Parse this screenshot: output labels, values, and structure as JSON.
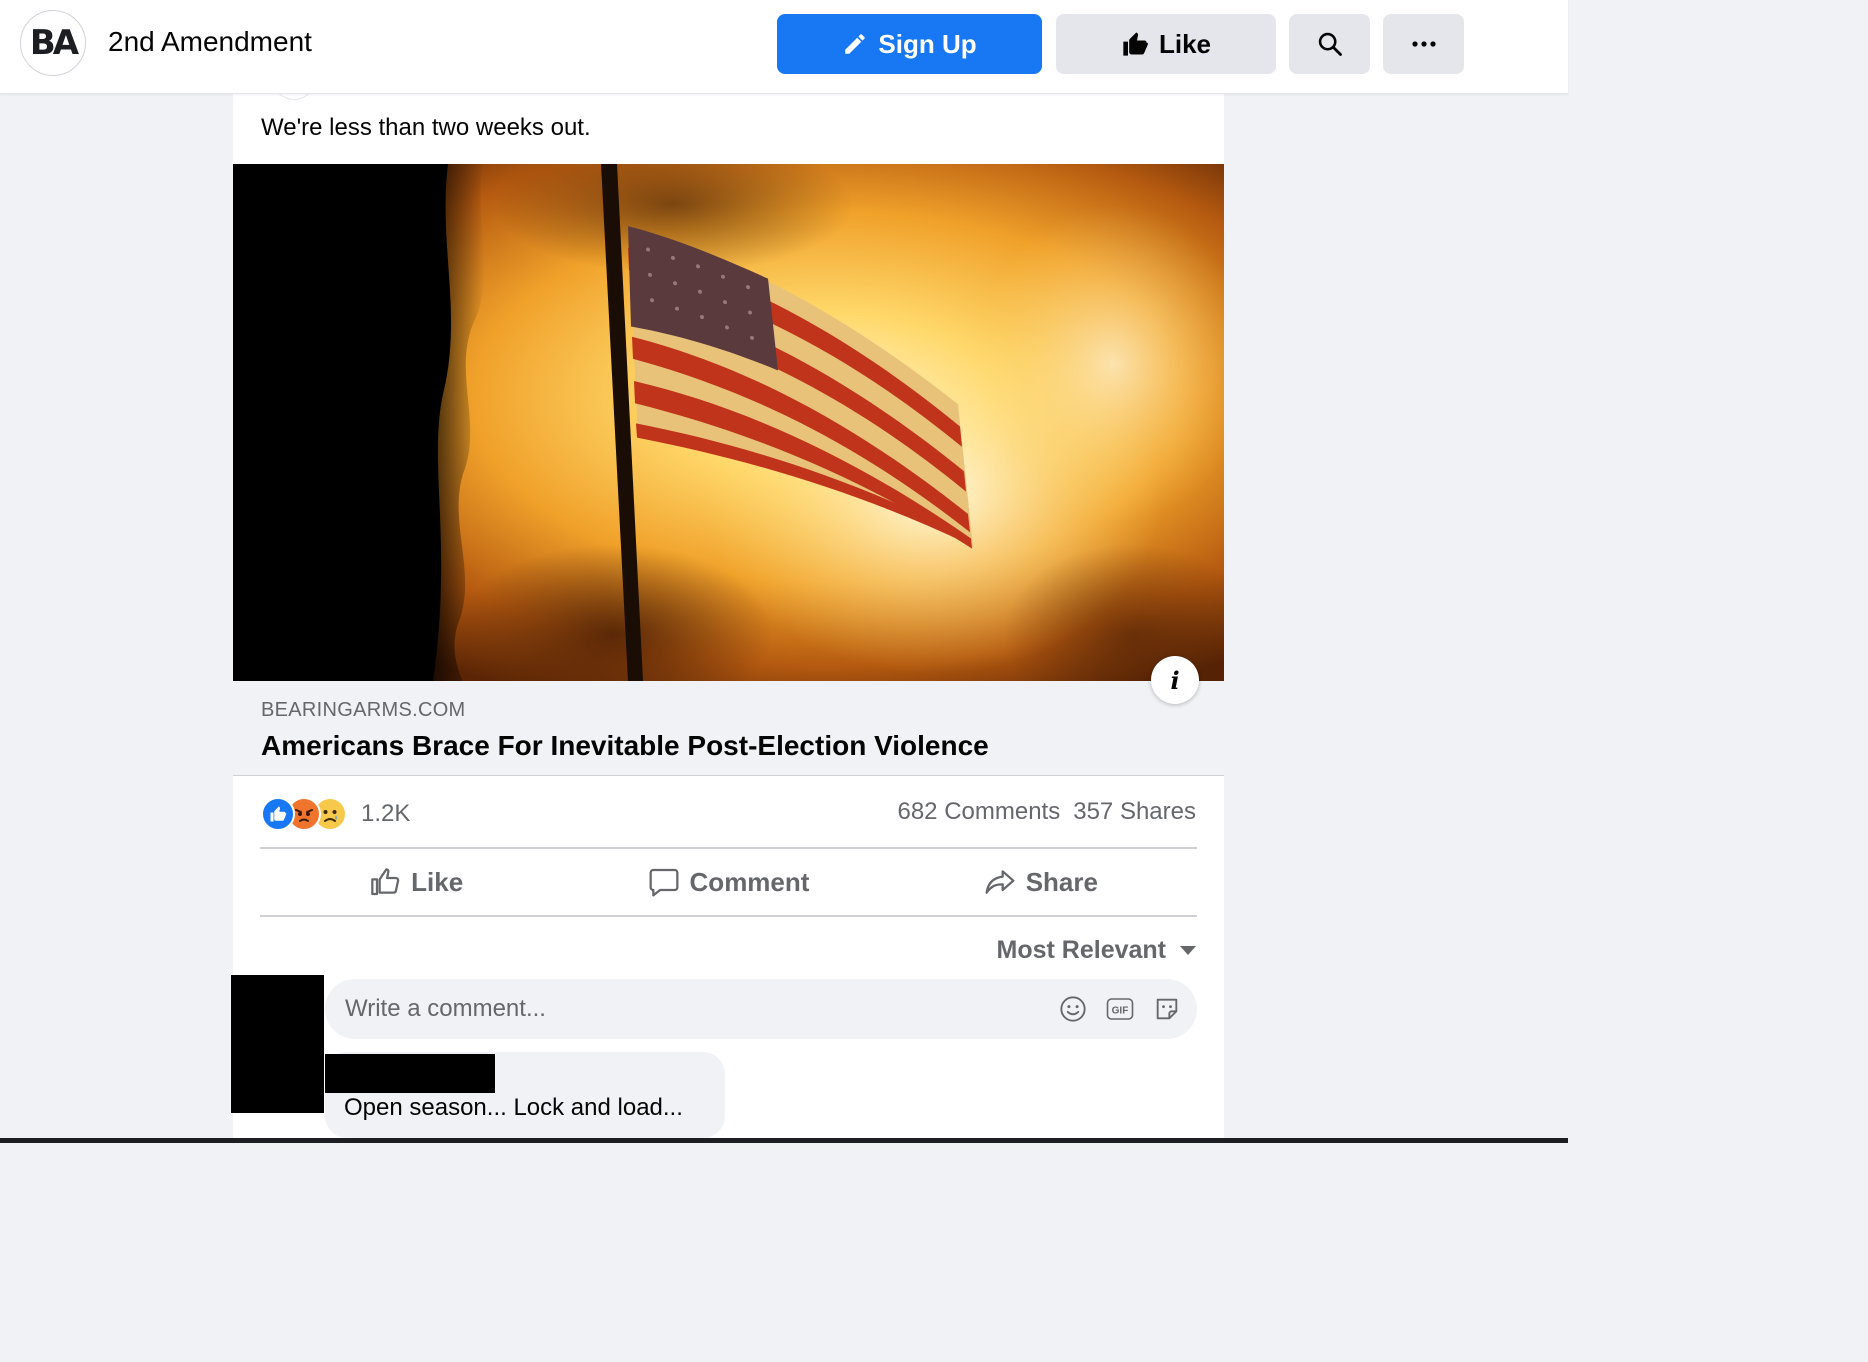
{
  "header": {
    "logo_text": "BA",
    "page_name": "2nd Amendment",
    "signup_label": "Sign Up",
    "like_label": "Like",
    "icons": {
      "signup": "pencil-icon",
      "like": "thumbs-up-icon",
      "search": "search-icon",
      "more": "more-dots-icon"
    }
  },
  "post": {
    "text": "We're less than two weeks out.",
    "image_description_icon": "info-icon",
    "link": {
      "domain": "BEARINGARMS.COM",
      "title": "Americans Brace For Inevitable Post-Election Violence"
    },
    "reactions": {
      "types": [
        "like",
        "angry",
        "sad"
      ],
      "count": "1.2K"
    },
    "comments_count": "682 Comments",
    "shares_count": "357 Shares",
    "actions": {
      "like": "Like",
      "comment": "Comment",
      "share": "Share"
    },
    "sort_label": "Most Relevant",
    "comment_placeholder": "Write a comment...",
    "comment_tools": [
      "emoji-icon",
      "gif-icon",
      "sticker-icon"
    ]
  },
  "comments": [
    {
      "text": "Open season... Lock and load..."
    }
  ],
  "colors": {
    "brand_blue": "#1877f2",
    "button_grey": "#e4e6eb",
    "secondary_text": "#65676b",
    "background": "#f0f2f5"
  }
}
